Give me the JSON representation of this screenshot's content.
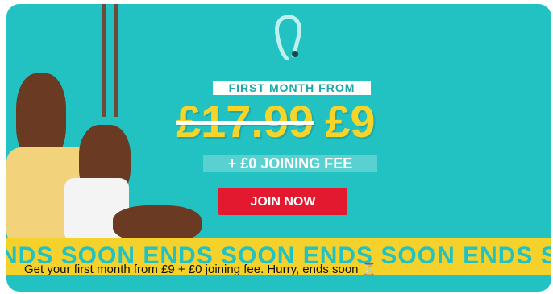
{
  "ad": {
    "headline": "FIRST MONTH FROM",
    "price_old": "£17.99",
    "price_new": "£9",
    "joining_fee": "+ £0 JOINING FEE",
    "cta_label": "JOIN NOW",
    "banner_text": "NDS SOON ENDS SOON ENDS SOON ENDS SOON ENDS SO"
  },
  "caption": {
    "text": "Get your first month from £9 + £0 joining fee. Hurry, ends soon",
    "emoji": "⏳"
  },
  "colors": {
    "background": "#23c2c2",
    "price": "#f7d42a",
    "cta": "#e3192f",
    "banner": "#f5d22b"
  },
  "icons": {
    "logo": "brand-logo"
  }
}
